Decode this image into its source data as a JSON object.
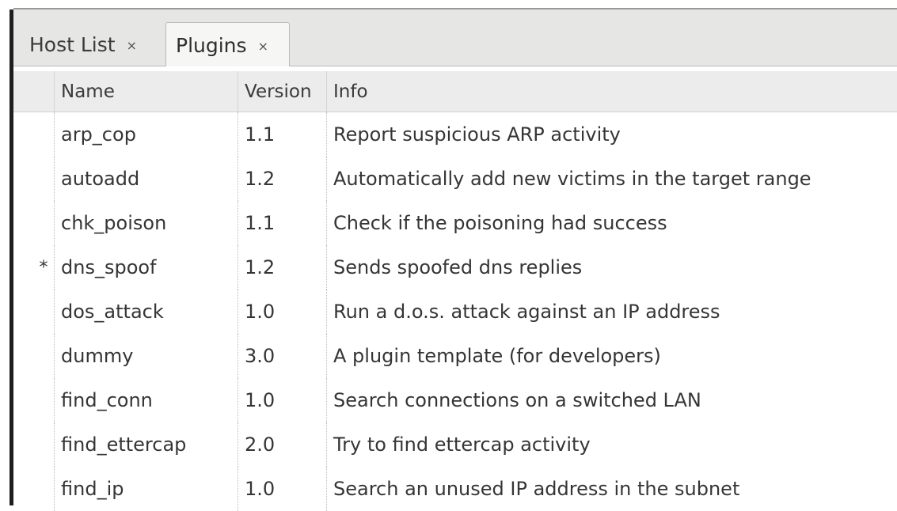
{
  "tabs": [
    {
      "label": "Host List",
      "close": "×"
    },
    {
      "label": "Plugins",
      "close": "×"
    }
  ],
  "columns": {
    "name": "Name",
    "version": "Version",
    "info": "Info"
  },
  "plugins": [
    {
      "mark": "",
      "name": "arp_cop",
      "version": "1.1",
      "info": "Report suspicious ARP activity"
    },
    {
      "mark": "",
      "name": "autoadd",
      "version": "1.2",
      "info": "Automatically add new victims in the target range"
    },
    {
      "mark": "",
      "name": "chk_poison",
      "version": "1.1",
      "info": "Check if the poisoning had success"
    },
    {
      "mark": "*",
      "name": "dns_spoof",
      "version": "1.2",
      "info": "Sends spoofed dns replies"
    },
    {
      "mark": "",
      "name": "dos_attack",
      "version": "1.0",
      "info": "Run a d.o.s. attack against an IP address"
    },
    {
      "mark": "",
      "name": "dummy",
      "version": "3.0",
      "info": "A plugin template (for developers)"
    },
    {
      "mark": "",
      "name": "find_conn",
      "version": "1.0",
      "info": "Search connections on a switched LAN"
    },
    {
      "mark": "",
      "name": "find_ettercap",
      "version": "2.0",
      "info": "Try to find ettercap activity"
    },
    {
      "mark": "",
      "name": "find_ip",
      "version": "1.0",
      "info": "Search an unused IP address in the subnet"
    }
  ]
}
